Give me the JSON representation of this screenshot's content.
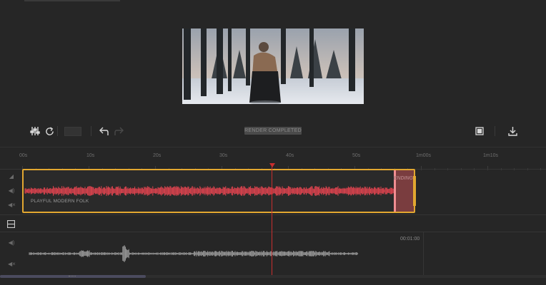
{
  "toolbar": {
    "adjust_icon": "sliders-icon",
    "replace_icon": "refresh-icon",
    "undo_icon": "undo-icon",
    "redo_icon": "redo-icon",
    "render_status": "RENDER COMPLETED",
    "fit_icon": "fit-to-screen-icon",
    "download_icon": "download-icon"
  },
  "ruler": {
    "labels": [
      "00s",
      "10s",
      "20s",
      "30s",
      "40s",
      "50s",
      "1m00s",
      "1m10s"
    ]
  },
  "music_track": {
    "clip_name": "PLAYFUL MODERN FOLK",
    "fade_label": "ENDING",
    "waveform_color": "#e0444f",
    "clip_border_color": "#e2a730"
  },
  "voice_track": {
    "time_label": "00:01:00",
    "waveform_color": "#9a9a9a"
  },
  "colors": {
    "background": "#262626",
    "playhead": "#c92e2e"
  }
}
